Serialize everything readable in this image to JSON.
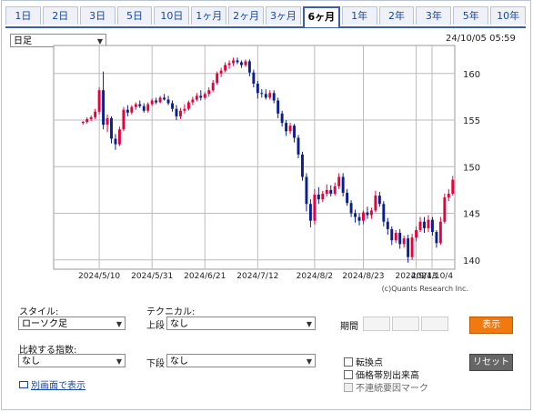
{
  "tabs": [
    "1日",
    "2日",
    "3日",
    "5日",
    "10日",
    "1ヶ月",
    "2ヶ月",
    "3ヶ月",
    "6ヶ月",
    "1年",
    "2年",
    "3年",
    "5年",
    "10年"
  ],
  "active_tab": 8,
  "interval_select": "日足",
  "timestamp": "24/10/05 05:59",
  "copyright": "(c)Quants Research Inc.",
  "controls": {
    "style_label": "スタイル:",
    "style_value": "ローソク足",
    "technical_label": "テクニカル:",
    "upper_label": "上段",
    "upper_value": "なし",
    "lower_label": "下段",
    "lower_value": "なし",
    "compare_label": "比較する指数:",
    "compare_value": "なし",
    "period_label": "期間",
    "show_button": "表示",
    "reset_button": "リセット",
    "check_turning": "転換点",
    "check_volume_by_price": "価格帯別出来高",
    "check_discontinuity": "不連続要因マーク",
    "new_window_link": "別画面で表示"
  },
  "colors": {
    "up": "#e8003d",
    "down": "#0a1f8f",
    "tab_accent": "#3a5ea8",
    "show_button": "#f07a10",
    "reset_button": "#666666"
  },
  "chart_data": {
    "type": "candlestick",
    "ylim": [
      139,
      163
    ],
    "y_ticks": [
      140,
      145,
      150,
      155,
      160
    ],
    "x_tick_labels": [
      "2024/5/10",
      "2024/5/31",
      "2024/6/21",
      "2024/7/12",
      "2024/8/2",
      "2024/8/23",
      "2024/9/13",
      "2024/10/4"
    ],
    "candles": [
      [
        154.7,
        154.9,
        154.5,
        154.8
      ],
      [
        154.8,
        155.3,
        154.6,
        155.1
      ],
      [
        155.1,
        155.5,
        154.9,
        155.3
      ],
      [
        155.3,
        156.2,
        155.1,
        155.9
      ],
      [
        155.9,
        158.5,
        155.6,
        158.2
      ],
      [
        158.2,
        160.2,
        154.0,
        154.5
      ],
      [
        154.5,
        155.6,
        153.7,
        155.2
      ],
      [
        155.2,
        155.4,
        152.5,
        153.0
      ],
      [
        153.0,
        153.5,
        151.8,
        152.4
      ],
      [
        152.4,
        154.3,
        152.2,
        154.0
      ],
      [
        154.0,
        156.4,
        153.8,
        156.1
      ],
      [
        156.1,
        156.6,
        155.4,
        155.8
      ],
      [
        155.8,
        156.6,
        155.6,
        156.4
      ],
      [
        156.4,
        156.9,
        156.1,
        156.7
      ],
      [
        156.7,
        157.1,
        156.3,
        156.5
      ],
      [
        156.5,
        156.8,
        155.8,
        156.0
      ],
      [
        156.0,
        156.9,
        155.8,
        156.7
      ],
      [
        156.7,
        157.3,
        156.5,
        157.1
      ],
      [
        157.1,
        157.4,
        156.7,
        156.9
      ],
      [
        156.9,
        157.6,
        156.8,
        157.4
      ],
      [
        157.4,
        157.8,
        157.1,
        157.2
      ],
      [
        157.2,
        157.6,
        156.6,
        156.8
      ],
      [
        156.8,
        157.1,
        155.9,
        156.2
      ],
      [
        156.2,
        156.6,
        155.0,
        155.4
      ],
      [
        155.4,
        156.3,
        155.1,
        156.0
      ],
      [
        156.0,
        156.7,
        155.7,
        156.2
      ],
      [
        156.2,
        157.1,
        156.0,
        156.9
      ],
      [
        156.9,
        157.5,
        156.6,
        157.2
      ],
      [
        157.2,
        157.9,
        157.0,
        157.6
      ],
      [
        157.6,
        158.2,
        157.1,
        157.4
      ],
      [
        157.4,
        158.0,
        157.2,
        157.8
      ],
      [
        157.8,
        158.5,
        157.5,
        158.2
      ],
      [
        158.2,
        159.3,
        158.0,
        159.0
      ],
      [
        159.0,
        160.2,
        158.8,
        160.0
      ],
      [
        160.0,
        160.6,
        159.6,
        160.3
      ],
      [
        160.3,
        161.2,
        160.1,
        160.9
      ],
      [
        160.9,
        161.4,
        160.5,
        161.1
      ],
      [
        161.1,
        161.7,
        160.8,
        161.4
      ],
      [
        161.4,
        161.7,
        161.0,
        161.2
      ],
      [
        161.2,
        161.4,
        160.6,
        160.9
      ],
      [
        160.9,
        161.5,
        160.7,
        161.3
      ],
      [
        161.3,
        161.5,
        159.7,
        160.1
      ],
      [
        160.1,
        160.4,
        158.5,
        158.9
      ],
      [
        158.9,
        159.2,
        157.3,
        157.9
      ],
      [
        157.9,
        158.3,
        157.4,
        157.8
      ],
      [
        157.8,
        158.3,
        157.2,
        157.4
      ],
      [
        157.4,
        158.2,
        157.2,
        157.9
      ],
      [
        157.9,
        158.2,
        156.8,
        157.1
      ],
      [
        157.1,
        157.4,
        155.2,
        155.7
      ],
      [
        155.7,
        156.0,
        154.3,
        154.7
      ],
      [
        154.7,
        155.0,
        153.3,
        153.8
      ],
      [
        153.8,
        154.7,
        153.5,
        154.4
      ],
      [
        154.4,
        154.6,
        152.6,
        153.1
      ],
      [
        153.1,
        153.4,
        150.9,
        151.3
      ],
      [
        151.3,
        151.6,
        148.5,
        148.9
      ],
      [
        148.9,
        149.3,
        145.2,
        146.0
      ],
      [
        146.0,
        146.5,
        143.5,
        144.2
      ],
      [
        144.2,
        147.6,
        143.8,
        147.0
      ],
      [
        147.0,
        147.8,
        146.0,
        146.5
      ],
      [
        146.5,
        147.4,
        146.2,
        147.1
      ],
      [
        147.1,
        148.1,
        146.8,
        147.5
      ],
      [
        147.5,
        148.0,
        146.8,
        147.1
      ],
      [
        147.1,
        148.3,
        146.9,
        147.9
      ],
      [
        147.9,
        149.3,
        147.6,
        148.9
      ],
      [
        148.9,
        149.3,
        146.8,
        147.2
      ],
      [
        147.2,
        147.6,
        145.8,
        146.1
      ],
      [
        146.1,
        146.4,
        144.6,
        145.0
      ],
      [
        145.0,
        145.4,
        144.0,
        144.6
      ],
      [
        144.6,
        145.0,
        143.7,
        144.2
      ],
      [
        144.2,
        145.3,
        143.8,
        145.1
      ],
      [
        145.1,
        145.7,
        144.4,
        144.8
      ],
      [
        144.8,
        145.6,
        144.4,
        145.3
      ],
      [
        145.3,
        147.4,
        145.1,
        146.9
      ],
      [
        146.9,
        147.3,
        145.7,
        146.0
      ],
      [
        146.0,
        146.3,
        143.6,
        144.1
      ],
      [
        144.1,
        144.5,
        142.7,
        143.3
      ],
      [
        143.3,
        143.6,
        141.6,
        142.1
      ],
      [
        142.1,
        143.2,
        141.8,
        142.9
      ],
      [
        142.9,
        143.3,
        141.2,
        141.7
      ],
      [
        141.7,
        142.6,
        141.3,
        142.3
      ],
      [
        142.3,
        142.7,
        139.7,
        140.3
      ],
      [
        140.3,
        142.8,
        140.0,
        142.4
      ],
      [
        142.4,
        143.6,
        142.0,
        143.2
      ],
      [
        143.2,
        144.6,
        143.0,
        144.1
      ],
      [
        144.1,
        144.6,
        142.9,
        143.4
      ],
      [
        143.4,
        144.8,
        143.0,
        144.3
      ],
      [
        144.3,
        144.6,
        142.6,
        143.0
      ],
      [
        143.0,
        143.2,
        141.3,
        141.8
      ],
      [
        141.8,
        144.6,
        141.6,
        144.1
      ],
      [
        144.1,
        147.1,
        143.9,
        146.7
      ],
      [
        146.7,
        147.6,
        146.3,
        147.1
      ],
      [
        147.1,
        149.0,
        146.9,
        148.6
      ]
    ]
  }
}
